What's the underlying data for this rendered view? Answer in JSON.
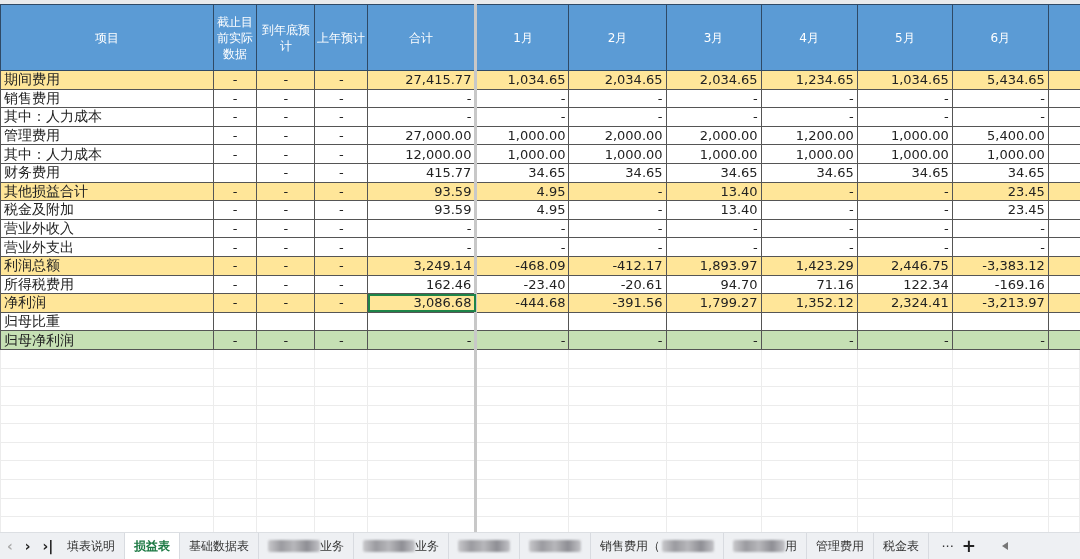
{
  "table": {
    "columns": [
      {
        "label": "项目",
        "kind": "label"
      },
      {
        "label": "截止目前实际数据",
        "kind": "narrow"
      },
      {
        "label": "到年底预计",
        "kind": "narrow"
      },
      {
        "label": "上年预计",
        "kind": "narrow"
      },
      {
        "label": "合计",
        "kind": "total"
      },
      {
        "label": "1月",
        "kind": "month"
      },
      {
        "label": "2月",
        "kind": "month"
      },
      {
        "label": "3月",
        "kind": "month"
      },
      {
        "label": "4月",
        "kind": "month"
      },
      {
        "label": "5月",
        "kind": "month"
      },
      {
        "label": "6月",
        "kind": "month"
      }
    ],
    "rows": [
      {
        "kind": "subtotal",
        "total_selected": false,
        "cells": [
          "期间费用",
          "-",
          "-",
          "-",
          "27,415.77",
          "1,034.65",
          "2,034.65",
          "2,034.65",
          "1,234.65",
          "1,034.65",
          "5,434.65"
        ]
      },
      {
        "kind": "normal",
        "total_selected": false,
        "cells": [
          "销售费用",
          "-",
          "-",
          "-",
          "-",
          "-",
          "-",
          "-",
          "-",
          "-",
          "-"
        ]
      },
      {
        "kind": "normal",
        "total_selected": false,
        "cells": [
          "其中：人力成本",
          "-",
          "-",
          "-",
          "-",
          "-",
          "-",
          "-",
          "-",
          "-",
          "-"
        ]
      },
      {
        "kind": "normal",
        "total_selected": false,
        "cells": [
          "管理费用",
          "-",
          "-",
          "-",
          "27,000.00",
          "1,000.00",
          "2,000.00",
          "2,000.00",
          "1,200.00",
          "1,000.00",
          "5,400.00"
        ]
      },
      {
        "kind": "normal",
        "total_selected": false,
        "cells": [
          "其中：人力成本",
          "-",
          "-",
          "-",
          "12,000.00",
          "1,000.00",
          "1,000.00",
          "1,000.00",
          "1,000.00",
          "1,000.00",
          "1,000.00"
        ]
      },
      {
        "kind": "normal",
        "total_selected": false,
        "cells": [
          "财务费用",
          null,
          "-",
          "-",
          "415.77",
          "34.65",
          "34.65",
          "34.65",
          "34.65",
          "34.65",
          "34.65"
        ]
      },
      {
        "kind": "subtotal",
        "total_selected": false,
        "cells": [
          "其他损益合计",
          "-",
          "-",
          "-",
          "93.59",
          "4.95",
          "-",
          "13.40",
          "-",
          "-",
          "23.45"
        ]
      },
      {
        "kind": "normal",
        "total_selected": false,
        "cells": [
          "税金及附加",
          "-",
          "-",
          "-",
          "93.59",
          "4.95",
          "-",
          "13.40",
          "-",
          "-",
          "23.45"
        ]
      },
      {
        "kind": "normal",
        "total_selected": false,
        "cells": [
          "营业外收入",
          "-",
          "-",
          "-",
          "-",
          "-",
          "-",
          "-",
          "-",
          "-",
          "-"
        ]
      },
      {
        "kind": "normal",
        "total_selected": false,
        "cells": [
          "营业外支出",
          "-",
          "-",
          "-",
          "-",
          "-",
          "-",
          "-",
          "-",
          "-",
          "-"
        ]
      },
      {
        "kind": "subtotal",
        "total_selected": false,
        "cells": [
          "利润总额",
          "-",
          "-",
          "-",
          "3,249.14",
          "-468.09",
          "-412.17",
          "1,893.97",
          "1,423.29",
          "2,446.75",
          "-3,383.12"
        ]
      },
      {
        "kind": "normal",
        "total_selected": false,
        "cells": [
          "所得税费用",
          "-",
          "-",
          "-",
          "162.46",
          "-23.40",
          "-20.61",
          "94.70",
          "71.16",
          "122.34",
          "-169.16"
        ]
      },
      {
        "kind": "subtotal",
        "total_selected": true,
        "cells": [
          "净利润",
          "-",
          "-",
          "-",
          "3,086.68",
          "-444.68",
          "-391.56",
          "1,799.27",
          "1,352.12",
          "2,324.41",
          "-3,213.97"
        ]
      },
      {
        "kind": "normal",
        "total_selected": false,
        "cells": [
          "归母比重",
          null,
          null,
          null,
          null,
          null,
          null,
          null,
          null,
          null,
          null
        ]
      },
      {
        "kind": "highlight",
        "total_selected": false,
        "cells": [
          "归母净利润",
          "-",
          "-",
          "-",
          "-",
          "-",
          "-",
          "-",
          "-",
          "-",
          "-"
        ]
      }
    ]
  },
  "sheet_nav": [
    "‹",
    "›",
    "›|"
  ],
  "sheet_tabs": [
    {
      "selected": false,
      "parts": [
        {
          "kind": "text",
          "text": "填表说明"
        }
      ]
    },
    {
      "selected": true,
      "parts": [
        {
          "kind": "text",
          "text": "损益表"
        }
      ]
    },
    {
      "selected": false,
      "parts": [
        {
          "kind": "text",
          "text": "基础数据表"
        }
      ]
    },
    {
      "selected": false,
      "parts": [
        {
          "kind": "blur"
        },
        {
          "kind": "text",
          "text": "业务"
        }
      ]
    },
    {
      "selected": false,
      "parts": [
        {
          "kind": "blur"
        },
        {
          "kind": "text",
          "text": "业务"
        }
      ]
    },
    {
      "selected": false,
      "parts": [
        {
          "kind": "blur"
        }
      ]
    },
    {
      "selected": false,
      "parts": [
        {
          "kind": "blur"
        }
      ]
    },
    {
      "selected": false,
      "parts": [
        {
          "kind": "text",
          "text": "销售费用（"
        },
        {
          "kind": "blur"
        }
      ]
    },
    {
      "selected": false,
      "parts": [
        {
          "kind": "blur"
        },
        {
          "kind": "text",
          "text": "用"
        }
      ]
    },
    {
      "selected": false,
      "parts": [
        {
          "kind": "text",
          "text": "管理费用"
        }
      ]
    },
    {
      "selected": false,
      "parts": [
        {
          "kind": "text",
          "text": "税金表"
        }
      ]
    }
  ],
  "more_tabs": "···",
  "add_sheet": "+"
}
